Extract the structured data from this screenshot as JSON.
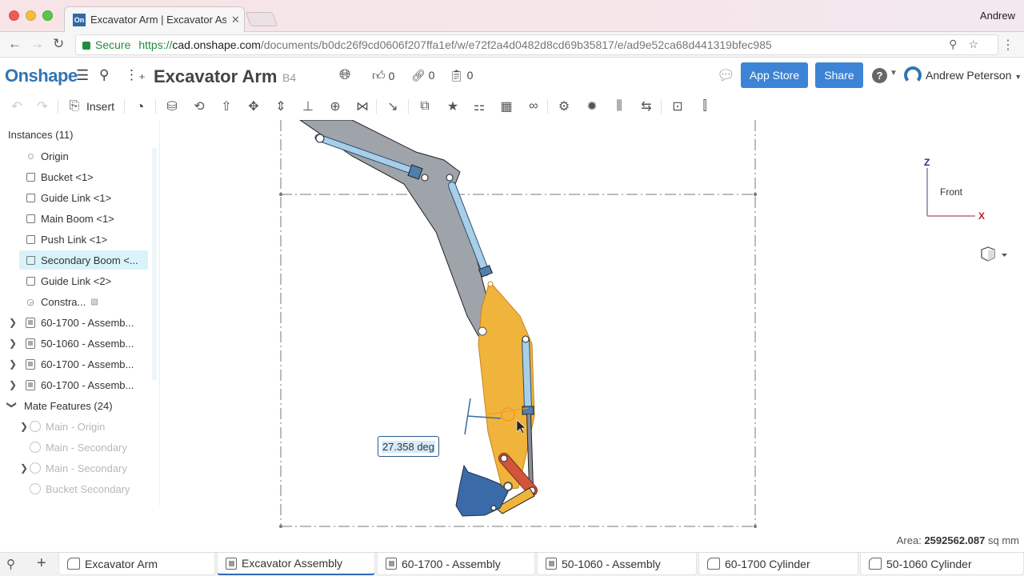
{
  "browser": {
    "tab_title": "Excavator Arm | Excavator Assembly",
    "favicon_text": "On",
    "user": "Andrew",
    "secure_label": "Secure",
    "url_scheme": "https://",
    "url_host": "cad.onshape.com",
    "url_path": "/documents/b0dc26f9cd0606f207ffa1ef/w/e72f2a4d0482d8cd69b35817/e/ad9e52ca68d441319bfec985"
  },
  "appbar": {
    "logo": "Onshape",
    "document_title": "Excavator Arm",
    "version": "B4",
    "likes": "0",
    "links": "0",
    "copies": "0",
    "app_store_label": "App Store",
    "share_label": "Share",
    "user_name": "Andrew Peterson"
  },
  "toolbar": {
    "insert_label": "Insert",
    "tools": [
      "undo-icon",
      "redo-icon",
      "insert-icon",
      "mate-connector-icon",
      "fastened-mate-icon",
      "revolute-mate-icon",
      "slider-mate-icon",
      "planar-mate-icon",
      "cylindrical-mate-icon",
      "pin-slot-mate-icon",
      "ball-mate-icon",
      "parallel-mate-icon",
      "tangent-mate-icon",
      "group-icon",
      "mate-connector-star-icon",
      "linear-relation-icon",
      "replicate-icon",
      "pattern-icon",
      "gear-relation-icon",
      "rack-pinion-icon",
      "screw-relation-icon",
      "exploded-view-icon",
      "section-icon",
      "create-part-studio-icon"
    ]
  },
  "instances_panel": {
    "heading": "Instances (11)",
    "items": [
      {
        "label": "Origin",
        "icon": "origin-icon"
      },
      {
        "label": "Bucket <1>",
        "icon": "part-icon"
      },
      {
        "label": "Guide Link <1>",
        "icon": "part-icon"
      },
      {
        "label": "Main Boom <1>",
        "icon": "part-icon"
      },
      {
        "label": "Push Link <1>",
        "icon": "part-icon"
      },
      {
        "label": "Secondary Boom <...",
        "icon": "part-icon",
        "selected": true
      },
      {
        "label": "Guide Link <2>",
        "icon": "part-icon"
      },
      {
        "label": "Constra...",
        "icon": "constraint-icon"
      },
      {
        "label": "60-1700 - Assemb...",
        "icon": "assembly-icon"
      },
      {
        "label": "50-1060 - Assemb...",
        "icon": "assembly-icon"
      },
      {
        "label": "60-1700 - Assemb...",
        "icon": "assembly-icon"
      },
      {
        "label": "60-1700 - Assemb...",
        "icon": "assembly-icon"
      }
    ],
    "mates_heading": "Mate Features (24)",
    "mates": [
      {
        "label": "Main - Origin",
        "icon": "cylindrical-mate-icon"
      },
      {
        "label": "Main - Secondary",
        "icon": "revolute-mate-icon"
      },
      {
        "label": "Main - Secondary",
        "icon": "cylindrical-mate-icon"
      },
      {
        "label": "Bucket Secondary",
        "icon": "revolute-mate-icon"
      }
    ]
  },
  "viewport": {
    "angle_readout": "27.358 deg",
    "view_label": "Front",
    "axis_z": "Z",
    "axis_x": "X",
    "area_label": "Area:",
    "area_value": "2592562.087",
    "area_unit": "sq mm"
  },
  "bottom_tabs": [
    {
      "label": "Excavator Arm",
      "type": "part"
    },
    {
      "label": "Excavator Assembly",
      "type": "assembly",
      "active": true
    },
    {
      "label": "60-1700 - Assembly",
      "type": "assembly"
    },
    {
      "label": "50-1060 - Assembly",
      "type": "assembly"
    },
    {
      "label": "60-1700 Cylinder",
      "type": "part"
    },
    {
      "label": "50-1060 Cylinder",
      "type": "part"
    }
  ],
  "colors": {
    "brand": "#2f75b5",
    "button": "#3d84d6",
    "selection": "#d9f3fa",
    "boom": "#9fa3aa",
    "secondary_boom": "#f0b43c",
    "cylinder": "#a7cfe8",
    "bucket": "#3b6aa8",
    "push_link": "#d2553a"
  }
}
